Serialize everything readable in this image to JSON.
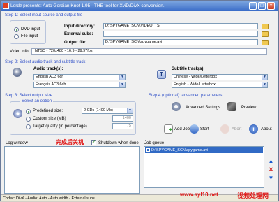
{
  "title_bar": {
    "title": "Lordz presents: Auto Gordian Knot 1.95 - THE tool for XviD/DivX conversion.",
    "min": "_",
    "max": "□",
    "close": "×"
  },
  "step1": {
    "label": "Step 1: Select input source and output file",
    "dvd_input": "DVD input",
    "file_input": "File input",
    "input_dir_label": "Input directory:",
    "input_dir_value": "D:\\SPYGAME_SCN\\VIDEO_TS",
    "external_subs_label": "External subs:",
    "external_subs_value": "",
    "output_file_label": "Output file:",
    "output_file_value": "D:\\SPYGAME_SCN\\spygame.avi",
    "video_info_label": "Video info:",
    "video_info_value": "NTSC - 720x480 - 16:9 - 29.97fps"
  },
  "step2": {
    "label": "Step 2: Select audio track and subtitle track",
    "audio_label": "Audio track(s):",
    "audio_track1": "English AC3 6ch",
    "audio_track2": "Français AC3 6ch",
    "subtitle_label": "Subtitle track(s):",
    "subtitle1": "Chinese - Wide/Letterbox",
    "subtitle2": "English - Wide/Letterbox"
  },
  "step3": {
    "label": "Step 3: Select output size",
    "select_option": "Select an option",
    "predefined": "Predefined size:",
    "predefined_value": "2 CDs (1400 Mb)",
    "custom": "Custom size (MB)",
    "custom_value": "1400",
    "target": "Target quality (in percentage)",
    "target_value": "75"
  },
  "step4": {
    "label": "Step 4 (optional): advanced parameters",
    "advanced": "Advanced Settings",
    "preview": "Preview",
    "add_job": "Add Job",
    "start": "Start",
    "abort": "Abort",
    "about": "About"
  },
  "log": {
    "label": "Log window",
    "shutdown": "Shutdown when done"
  },
  "job_queue": {
    "label": "Job queue",
    "item": "D:\\SPYGAME_SCN\\spygame.avi"
  },
  "status": {
    "text": "Codec: DivX -   Audio: Auto -   Auto width - External subs"
  },
  "overlay": {
    "cn_label": "完成后关机",
    "url": "www.ayl10.net",
    "cn_brand": "视频处理网"
  }
}
